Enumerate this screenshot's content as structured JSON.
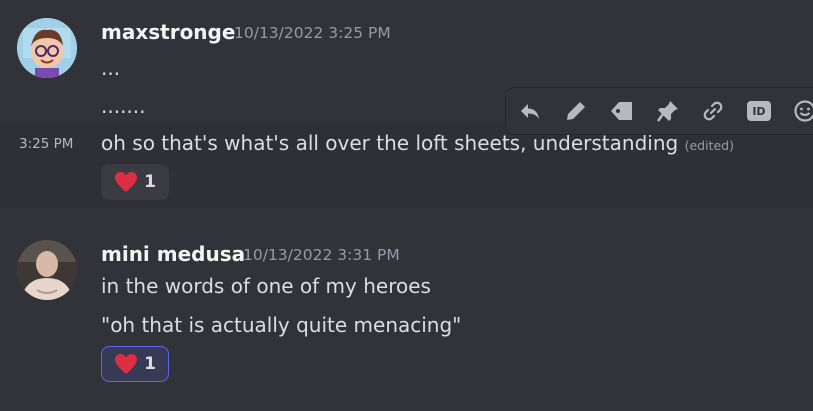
{
  "messages": [
    {
      "author": "maxstronge",
      "timestamp": "10/13/2022 3:25 PM",
      "lines": [
        "...",
        "......."
      ]
    },
    {
      "side_time": "3:25 PM",
      "text": "oh so that's what's all over the loft sheets, understanding",
      "edited": "(edited)",
      "reaction": {
        "emoji": "heart-icon",
        "count": "1",
        "active": false
      }
    },
    {
      "author": "mini medusa",
      "timestamp": "10/13/2022 3:31 PM",
      "lines": [
        "in the words of one of my heroes",
        "\"oh that is actually quite menacing\""
      ],
      "reaction": {
        "emoji": "heart-icon",
        "count": "1",
        "active": true
      }
    }
  ],
  "toolbar": {
    "buttons": [
      "reply-icon",
      "edit-icon",
      "tag-icon",
      "pin-icon",
      "link-icon",
      "id-icon",
      "add-reaction-icon"
    ],
    "id_label": "ID"
  },
  "colors": {
    "background": "#313338",
    "hover_background": "#2e3035",
    "reaction_active_border": "#5865f2",
    "heart": "#dd2e44"
  }
}
